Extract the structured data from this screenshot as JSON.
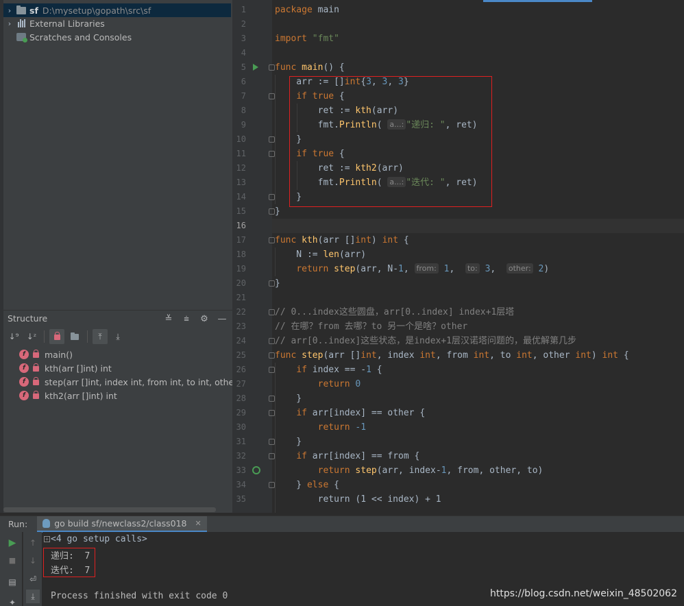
{
  "project_tree": {
    "root_name": "sf",
    "root_path": "D:\\mysetup\\gopath\\src\\sf",
    "external_libraries": "External Libraries",
    "scratches": "Scratches and Consoles"
  },
  "structure": {
    "title": "Structure",
    "items": [
      {
        "badge": "f",
        "label": "main()"
      },
      {
        "badge": "f",
        "label": "kth(arr []int) int"
      },
      {
        "badge": "f",
        "label": "step(arr []int, index int, from int, to int, other int"
      },
      {
        "badge": "f",
        "label": "kth2(arr []int) int"
      }
    ]
  },
  "editor": {
    "line_numbers": [
      "1",
      "2",
      "3",
      "4",
      "5",
      "6",
      "7",
      "8",
      "9",
      "10",
      "11",
      "12",
      "13",
      "14",
      "15",
      "16",
      "17",
      "18",
      "19",
      "20",
      "21",
      "22",
      "23",
      "24",
      "25",
      "26",
      "27",
      "28",
      "29",
      "30",
      "31",
      "32",
      "33",
      "34",
      "35"
    ],
    "current_line": "16",
    "code": {
      "l1_kw": "package",
      "l1_rest": " main",
      "l3_kw": "import",
      "l3_str": "\"fmt\"",
      "l5_kw": "func",
      "l5_fn": "main",
      "l5_rest": "() {",
      "l6_a": "    arr := []",
      "l6_kw": "int",
      "l6_b": "{",
      "l6_n1": "3",
      "l6_c1": ", ",
      "l6_n2": "3",
      "l6_c2": ", ",
      "l6_n3": "3",
      "l6_d": "}",
      "l7_kw1": "if",
      "l7_kw2": "true",
      "l7_rest": " {",
      "l8_a": "        ret := ",
      "l8_fn": "kth",
      "l8_b": "(arr)",
      "l9_a": "        fmt.",
      "l9_fn": "Println",
      "l9_hint": "a...:",
      "l9_str": "\"递归: \"",
      "l9_b": ", ret)",
      "l10": "    }",
      "l11_kw1": "if",
      "l11_kw2": "true",
      "l11_rest": " {",
      "l12_a": "        ret := ",
      "l12_fn": "kth2",
      "l12_b": "(arr)",
      "l13_a": "        fmt.",
      "l13_fn": "Println",
      "l13_hint": "a...:",
      "l13_str": "\"迭代: \"",
      "l13_b": ", ret)",
      "l14": "    }",
      "l15": "}",
      "l17_kw": "func",
      "l17_fn": "kth",
      "l17_a": "(arr []",
      "l17_kw2": "int",
      "l17_b": ") ",
      "l17_kw3": "int",
      "l17_c": " {",
      "l18_a": "    N := ",
      "l18_fn": "len",
      "l18_b": "(arr)",
      "l19_kw": "return",
      "l19_fn": "step",
      "l19_a": "(arr, N-",
      "l19_n1": "1",
      "l19_c": ", ",
      "l19_h1": "from:",
      "l19_n2": "1",
      "l19_h2": "to:",
      "l19_n3": "3",
      "l19_h3": "other:",
      "l19_n4": "2",
      "l19_d": ")",
      "l20": "}",
      "l22": "// 0...index这些圆盘，arr[0..index] index+1层塔",
      "l23": "// 在哪？from 去哪？to 另一个是啥？other",
      "l24": "// arr[0..index]这些状态，是index+1层汉诺塔问题的，最优解第几步",
      "l25_kw": "func",
      "l25_fn": "step",
      "l25_a": "(arr []",
      "l25_t1": "int",
      "l25_b": ", index ",
      "l25_t2": "int",
      "l25_c": ", from ",
      "l25_t3": "int",
      "l25_d": ", to ",
      "l25_t4": "int",
      "l25_e": ", other ",
      "l25_t5": "int",
      "l25_f": ") ",
      "l25_t6": "int",
      "l25_g": " {",
      "l26_kw": "if",
      "l26_a": " index == -",
      "l26_n": "1",
      "l26_b": " {",
      "l27_kw": "return",
      "l27_n": "0",
      "l28": "    }",
      "l29_kw": "if",
      "l29_a": " arr[index] == other {",
      "l30_kw": "return",
      "l30_n": "-1",
      "l31": "    }",
      "l32_kw": "if",
      "l32_a": " arr[index] == from {",
      "l33_kw": "return",
      "l33_fn": "step",
      "l33_a": "(arr, index-",
      "l33_n": "1",
      "l33_b": ", from, other, to)",
      "l34_a": "    } ",
      "l34_kw": "else",
      "l34_b": " {",
      "l35": "        return (1 << index) + 1"
    }
  },
  "run": {
    "label": "Run:",
    "tab_title": "go build sf/newclass2/class018",
    "setup_calls": "<4 go setup calls>",
    "output_lines": [
      "递归:  7",
      "迭代:  7"
    ],
    "finished": "Process finished with exit code 0"
  },
  "watermark": "https://blog.csdn.net/weixin_48502062",
  "colors": {
    "keyword": "#cc7832",
    "function": "#ffc66d",
    "string": "#6a8759",
    "number": "#6897bb",
    "comment": "#808080",
    "highlight_box": "#e02020"
  }
}
